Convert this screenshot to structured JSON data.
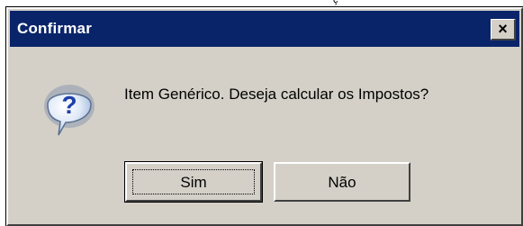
{
  "top_strip": {
    "glyph": "ç"
  },
  "dialog": {
    "title": "Confirmar",
    "close_label": "×",
    "icon": "question-icon",
    "message": "Item Genérico. Deseja calcular os Impostos?",
    "buttons": {
      "yes": "Sim",
      "no": "Não"
    }
  },
  "colors": {
    "titlebar": "#0a246a",
    "dialog_face": "#d4d0c8",
    "icon_bubble": "#1f5fd6"
  }
}
